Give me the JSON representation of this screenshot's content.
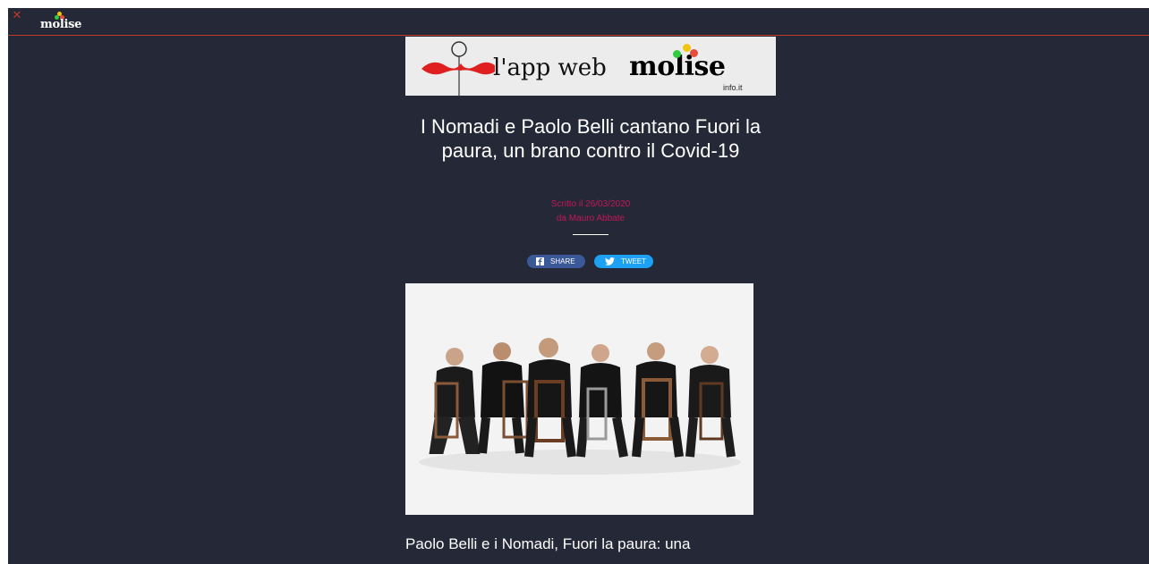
{
  "topbar": {
    "close_icon": "close-icon",
    "logo_text": "molise",
    "accent_color": "#c0392b"
  },
  "banner": {
    "text": "l'app web",
    "brand": "molise",
    "sub": "info.it",
    "mustache_color": "#e02020"
  },
  "article": {
    "title": "I Nomadi e Paolo Belli cantano Fuori la paura, un brano contro il Covid-19",
    "written_on": "Scritto il 26/03/2020",
    "author": "da Mauro Abbate",
    "meta_color": "#c2185b",
    "body_start": "Paolo Belli e i Nomadi, Fuori la paura: una"
  },
  "share": {
    "facebook_label": "SHARE",
    "facebook_icon": "facebook-icon",
    "facebook_color": "#3b5998",
    "twitter_label": "TWEET",
    "twitter_icon": "twitter-icon",
    "twitter_color": "#1da1f2"
  },
  "background_color": "#252836"
}
